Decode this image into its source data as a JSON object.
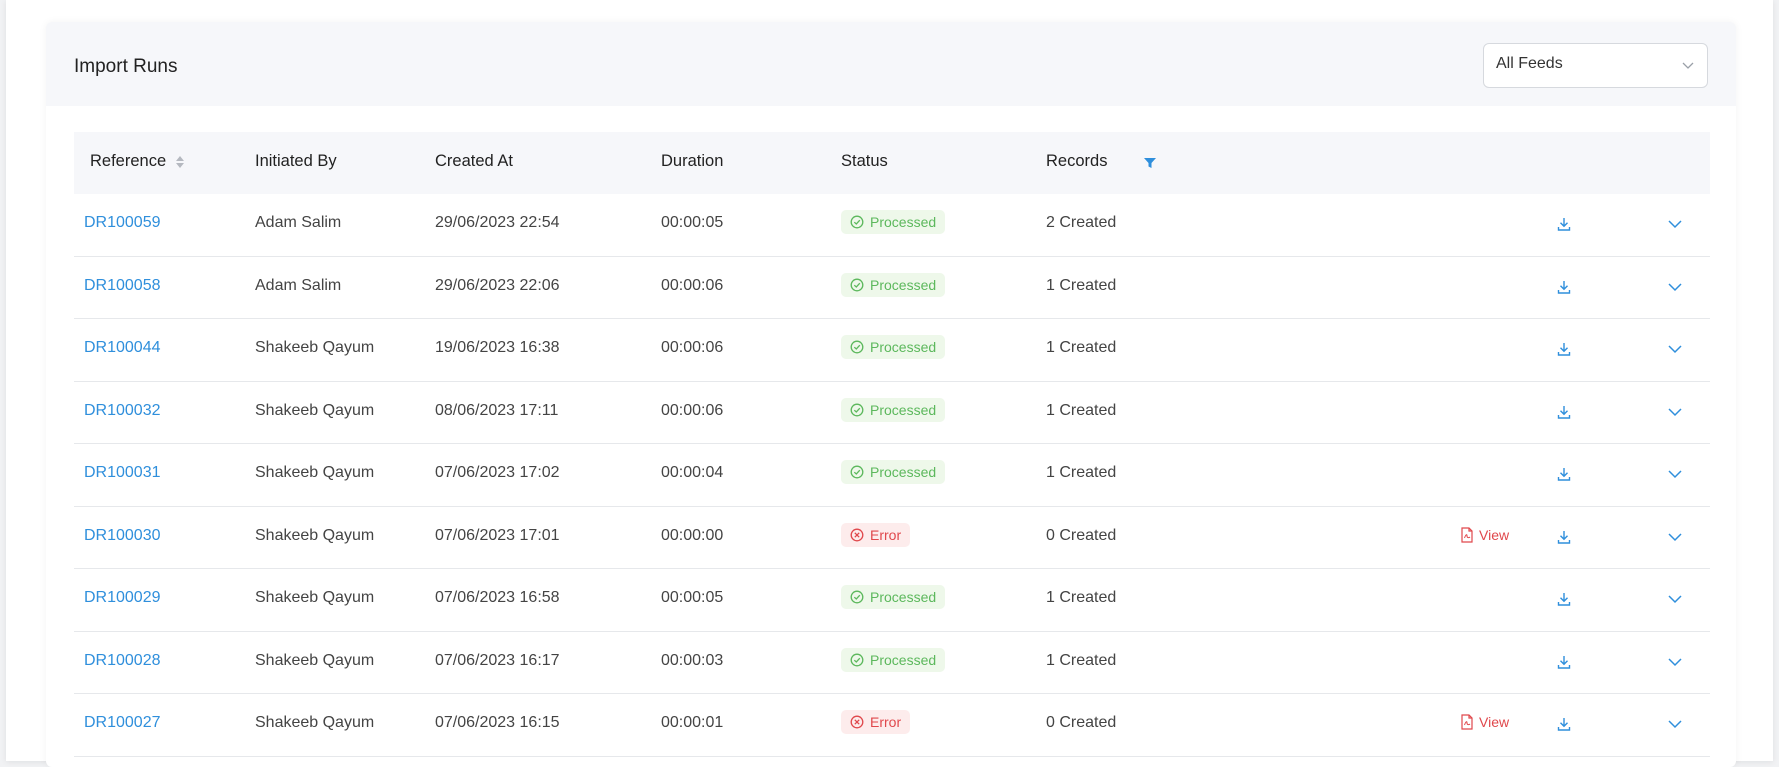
{
  "card": {
    "title": "Import Runs",
    "feed_select_value": "All Feeds"
  },
  "table": {
    "headers": {
      "reference": "Reference",
      "initiated_by": "Initiated By",
      "created_at": "Created At",
      "duration": "Duration",
      "status": "Status",
      "records": "Records"
    },
    "view_label": "View",
    "rows": [
      {
        "reference": "DR100059",
        "initiated_by": "Adam Salim",
        "created_at": "29/06/2023 22:54",
        "duration": "00:00:05",
        "status": "Processed",
        "status_type": "processed",
        "records": "2 Created",
        "has_view": false
      },
      {
        "reference": "DR100058",
        "initiated_by": "Adam Salim",
        "created_at": "29/06/2023 22:06",
        "duration": "00:00:06",
        "status": "Processed",
        "status_type": "processed",
        "records": "1 Created",
        "has_view": false
      },
      {
        "reference": "DR100044",
        "initiated_by": "Shakeeb Qayum",
        "created_at": "19/06/2023 16:38",
        "duration": "00:00:06",
        "status": "Processed",
        "status_type": "processed",
        "records": "1 Created",
        "has_view": false
      },
      {
        "reference": "DR100032",
        "initiated_by": "Shakeeb Qayum",
        "created_at": "08/06/2023 17:11",
        "duration": "00:00:06",
        "status": "Processed",
        "status_type": "processed",
        "records": "1 Created",
        "has_view": false
      },
      {
        "reference": "DR100031",
        "initiated_by": "Shakeeb Qayum",
        "created_at": "07/06/2023 17:02",
        "duration": "00:00:04",
        "status": "Processed",
        "status_type": "processed",
        "records": "1 Created",
        "has_view": false
      },
      {
        "reference": "DR100030",
        "initiated_by": "Shakeeb Qayum",
        "created_at": "07/06/2023 17:01",
        "duration": "00:00:00",
        "status": "Error",
        "status_type": "error",
        "records": "0 Created",
        "has_view": true
      },
      {
        "reference": "DR100029",
        "initiated_by": "Shakeeb Qayum",
        "created_at": "07/06/2023 16:58",
        "duration": "00:00:05",
        "status": "Processed",
        "status_type": "processed",
        "records": "1 Created",
        "has_view": false
      },
      {
        "reference": "DR100028",
        "initiated_by": "Shakeeb Qayum",
        "created_at": "07/06/2023 16:17",
        "duration": "00:00:03",
        "status": "Processed",
        "status_type": "processed",
        "records": "1 Created",
        "has_view": false
      },
      {
        "reference": "DR100027",
        "initiated_by": "Shakeeb Qayum",
        "created_at": "07/06/2023 16:15",
        "duration": "00:00:01",
        "status": "Error",
        "status_type": "error",
        "records": "0 Created",
        "has_view": true
      }
    ]
  },
  "colors": {
    "link": "#2f8fdc",
    "processed": "#5cb85c",
    "error": "#e0484c",
    "header_bg": "#f6f7fa"
  },
  "icons": {
    "sort": "sort-icon",
    "filter": "filter-icon",
    "download": "download-icon",
    "expand": "chevron-down-icon",
    "file": "file-pdf-icon",
    "check": "check-circle-icon",
    "error": "x-circle-icon"
  }
}
